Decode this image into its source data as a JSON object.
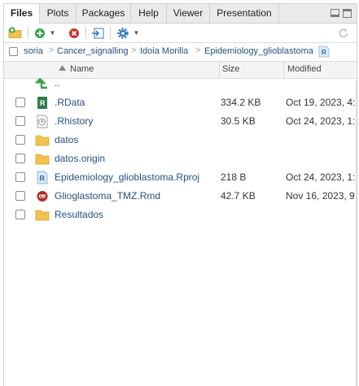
{
  "tabs": [
    {
      "label": "Files",
      "active": true
    },
    {
      "label": "Plots"
    },
    {
      "label": "Packages"
    },
    {
      "label": "Help"
    },
    {
      "label": "Viewer"
    },
    {
      "label": "Presentation"
    }
  ],
  "window_controls": {
    "minimize_icon": "minimize-icon",
    "maximize_icon": "maximize-icon"
  },
  "toolbar": {
    "icons": [
      "new-folder-icon",
      "new-blank-file-icon",
      "delete-icon",
      "rename-icon",
      "gear-icon",
      "refresh-icon"
    ]
  },
  "breadcrumb": {
    "items": [
      "soria",
      "Cancer_signalling",
      "Idoia Morilla",
      "Epidemiology_glioblastoma"
    ],
    "separator": ">",
    "project_icon": "r-project-icon"
  },
  "columns": {
    "name": "Name",
    "size": "Size",
    "modified": "Modified",
    "sort_icon": "sort-ascending-icon"
  },
  "files": [
    {
      "name": "..",
      "size": "",
      "modified": "",
      "icon": "go-up-icon",
      "checkbox": false
    },
    {
      "name": ".RData",
      "size": "334.2 KB",
      "modified": "Oct 19, 2023, 4:",
      "icon": "rdata-file-icon",
      "checkbox": true
    },
    {
      "name": ".Rhistory",
      "size": "30.5 KB",
      "modified": "Oct 24, 2023, 1:",
      "icon": "history-file-icon",
      "checkbox": true
    },
    {
      "name": "datos",
      "size": "",
      "modified": "",
      "icon": "folder-icon",
      "checkbox": true
    },
    {
      "name": "datos.origin",
      "size": "",
      "modified": "",
      "icon": "folder-icon",
      "checkbox": true
    },
    {
      "name": "Epidemiology_glioblastoma.Rproj",
      "size": "218 B",
      "modified": "Oct 24, 2023, 1:",
      "icon": "rproj-file-icon",
      "checkbox": true
    },
    {
      "name": "Glioglastoma_TMZ.Rmd",
      "size": "42.7 KB",
      "modified": "Nov 16, 2023, 9",
      "icon": "rmd-file-icon",
      "checkbox": true
    },
    {
      "name": "Resultados",
      "size": "",
      "modified": "",
      "icon": "folder-icon",
      "checkbox": true
    }
  ],
  "colors": {
    "link": "#24527a",
    "folder": "#f2c14e",
    "accent_green": "#3aa34a"
  }
}
